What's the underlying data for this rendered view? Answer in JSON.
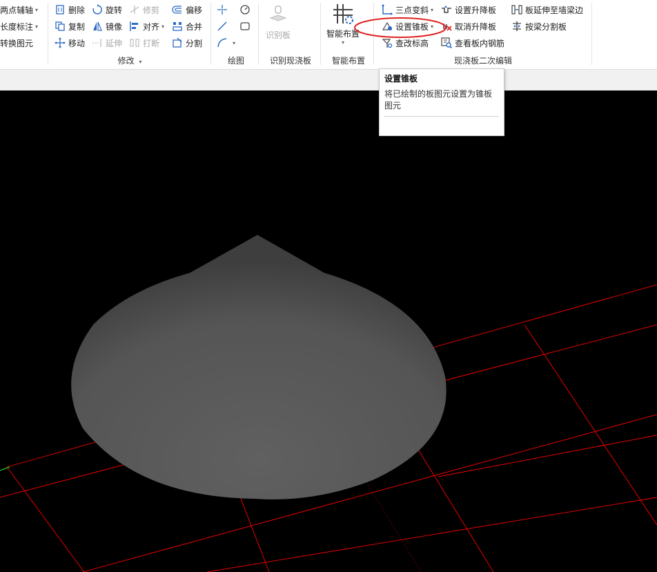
{
  "ribbon": {
    "axis_group": {
      "items": [
        {
          "label": "两点辅轴",
          "icon": "dropdown-arrow"
        },
        {
          "label": "长度标注",
          "icon": "dropdown-arrow"
        },
        {
          "label": "转换图元",
          "icon": "none"
        }
      ]
    },
    "modify_group": {
      "label": "修改",
      "items": {
        "delete": "删除",
        "rotate": "旋转",
        "trim": "修剪",
        "offset": "偏移",
        "copy": "复制",
        "mirror": "镜像",
        "align": "对齐",
        "merge": "合并",
        "move": "移动",
        "extend": "延伸",
        "break": "打断",
        "split": "分割"
      }
    },
    "draw_group": {
      "label": "绘图"
    },
    "identify_group": {
      "label": "识别现浇板",
      "button": "识别板"
    },
    "smart_group": {
      "label": "智能布置",
      "button": "智能布置"
    },
    "slab_edit_group": {
      "label": "现浇板二次编辑",
      "items": {
        "three_point_slope": "三点变斜",
        "set_cone_slab": "设置锥板",
        "check_elevation": "查改标高",
        "set_raise_slab": "设置升降板",
        "cancel_raise_slab": "取消升降板",
        "view_slab_rebar": "查看板内钢筋",
        "extend_to_beam": "板延伸至墙梁边",
        "split_by_beam": "按梁分割板"
      }
    }
  },
  "tooltip": {
    "title": "设置锥板",
    "description": "将已绘制的板图元设置为锥板图元"
  },
  "colors": {
    "highlight_ellipse": "#e02020",
    "grid_lines": "#ff0000",
    "cone_fill": "#5a5a5a",
    "viewport_bg": "#000000",
    "icon_blue": "#2d6bc4"
  }
}
